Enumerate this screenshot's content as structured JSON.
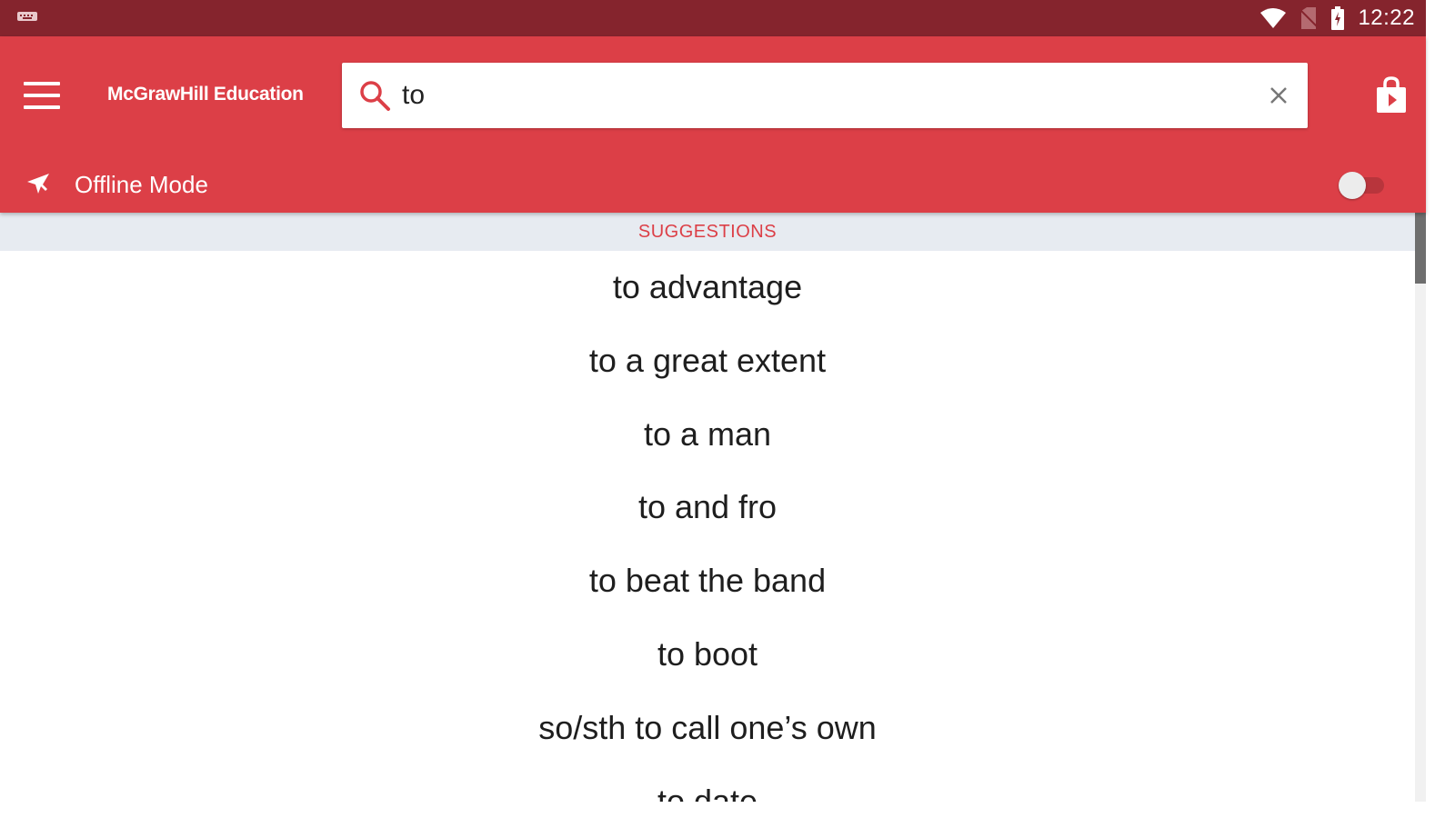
{
  "status_bar": {
    "time": "12:22",
    "icons": [
      "keyboard-icon",
      "wifi-icon",
      "no-sim-icon",
      "battery-icon"
    ]
  },
  "app_bar": {
    "brand": "McGrawHill Education",
    "menu_icon": "hamburger-menu-icon",
    "store_icon": "shopping-bag-icon",
    "background": "#dc3f47"
  },
  "search": {
    "value": "to",
    "placeholder": "",
    "search_icon": "search-icon",
    "clear_icon": "close-icon"
  },
  "offline": {
    "label": "Offline Mode",
    "icon": "airplane-icon",
    "enabled": false
  },
  "suggestions": {
    "header": "SUGGESTIONS",
    "items": [
      "to advantage",
      "to a great extent",
      "to a man",
      "to and fro",
      "to beat the band",
      "to boot",
      "so/sth to call one’s own",
      "to date"
    ]
  },
  "colors": {
    "status_bar": "#85242d",
    "accent": "#dc3f47",
    "header_bg": "#e7ebf1"
  }
}
